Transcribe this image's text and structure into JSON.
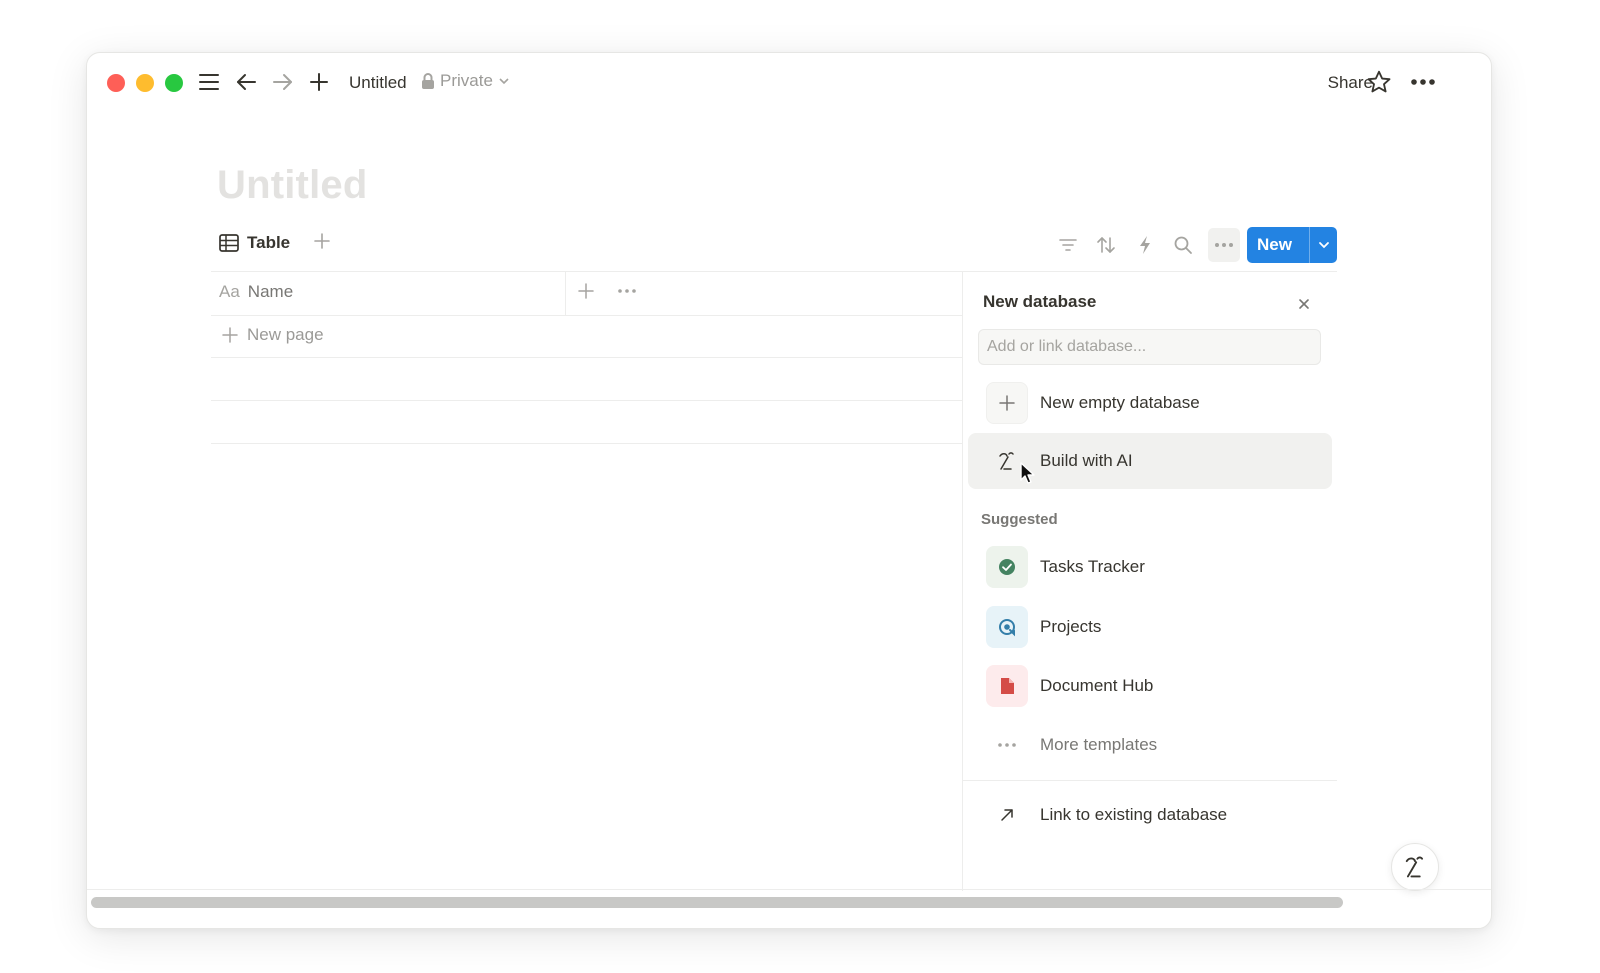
{
  "window": {
    "page_title_breadcrumb": "Untitled",
    "privacy_label": "Private",
    "share_label": "Share"
  },
  "page": {
    "title": "Untitled"
  },
  "view": {
    "tab_label": "Table",
    "new_button_label": "New",
    "columns": [
      {
        "label": "Name",
        "icon_text": "Aa"
      }
    ],
    "new_page_label": "New page"
  },
  "panel": {
    "title": "New database",
    "search_placeholder": "Add or link database...",
    "actions": [
      {
        "label": "New empty database",
        "icon": "plus-icon"
      },
      {
        "label": "Build with AI",
        "icon": "ai-icon"
      }
    ],
    "suggested_label": "Suggested",
    "suggested": [
      {
        "label": "Tasks Tracker",
        "icon": "check-circle-icon",
        "color": "#448361"
      },
      {
        "label": "Projects",
        "icon": "target-icon",
        "color": "#337ea9"
      },
      {
        "label": "Document Hub",
        "icon": "document-icon",
        "color": "#d44c47"
      }
    ],
    "more_templates_label": "More templates",
    "link_existing_label": "Link to existing database"
  },
  "colors": {
    "accent": "#2383e2",
    "text": "#37352f",
    "muted": "#9b9a97"
  }
}
